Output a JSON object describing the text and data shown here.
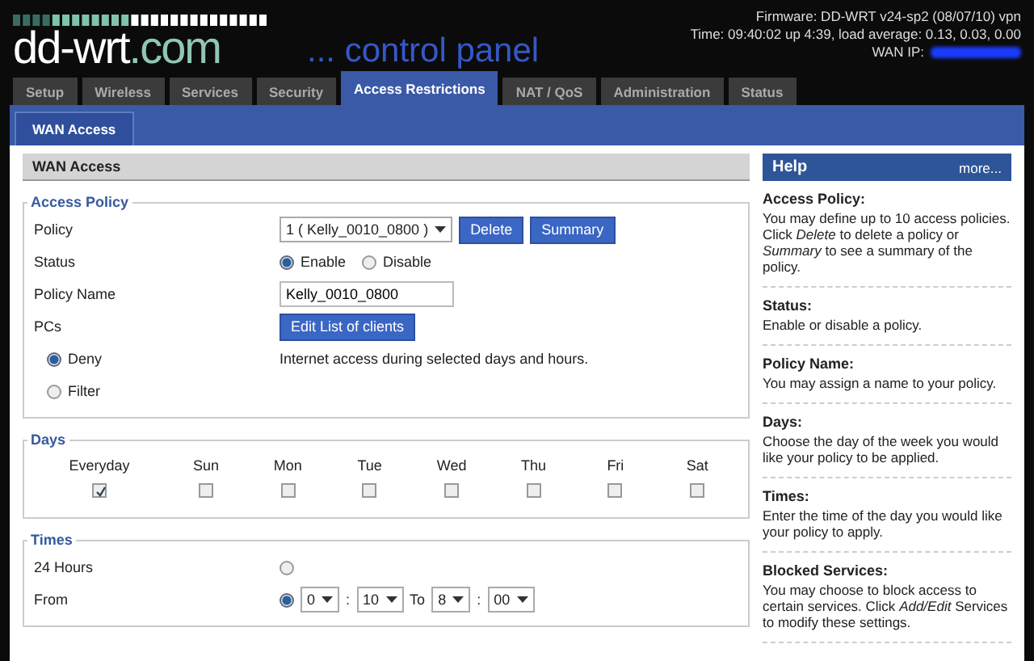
{
  "header": {
    "logo_main": "dd-wrt",
    "logo_domain": ".com",
    "tagline": "... control panel",
    "firmware": "Firmware: DD-WRT v24-sp2 (08/07/10) vpn",
    "time": "Time: 09:40:02 up 4:39, load average: 0.13, 0.03, 0.00",
    "wan_ip_label": "WAN IP:"
  },
  "tabs": [
    {
      "label": "Setup",
      "selected": false
    },
    {
      "label": "Wireless",
      "selected": false
    },
    {
      "label": "Services",
      "selected": false
    },
    {
      "label": "Security",
      "selected": false
    },
    {
      "label": "Access Restrictions",
      "selected": true
    },
    {
      "label": "NAT / QoS",
      "selected": false
    },
    {
      "label": "Administration",
      "selected": false
    },
    {
      "label": "Status",
      "selected": false
    }
  ],
  "subtabs": [
    {
      "label": "WAN Access",
      "selected": true
    }
  ],
  "main": {
    "title": "WAN Access",
    "access_policy": {
      "legend": "Access Policy",
      "policy_label": "Policy",
      "policy_value": "1 ( Kelly_0010_0800 )",
      "buttons": [
        "Delete",
        "Summary"
      ],
      "status_label": "Status",
      "status_options": [
        {
          "label": "Enable",
          "selected": true
        },
        {
          "label": "Disable",
          "selected": false
        }
      ],
      "name_label": "Policy Name",
      "name_value": "Kelly_0010_0800",
      "pcs_label": "PCs",
      "pcs_button": "Edit List of clients",
      "modes": [
        {
          "label": "Deny",
          "selected": true
        },
        {
          "label": "Filter",
          "selected": false
        }
      ],
      "mode_description": "Internet access during selected days and hours."
    },
    "days": {
      "legend": "Days",
      "items": [
        {
          "label": "Everyday",
          "checked": true
        },
        {
          "label": "Sun",
          "checked": false
        },
        {
          "label": "Mon",
          "checked": false
        },
        {
          "label": "Tue",
          "checked": false
        },
        {
          "label": "Wed",
          "checked": false
        },
        {
          "label": "Thu",
          "checked": false
        },
        {
          "label": "Fri",
          "checked": false
        },
        {
          "label": "Sat",
          "checked": false
        }
      ]
    },
    "times": {
      "legend": "Times",
      "all_day_label": "24 Hours",
      "all_day_selected": false,
      "from_label": "From",
      "from_selected": true,
      "from_hour": "0",
      "from_minute": "10",
      "to_label": "To",
      "to_hour": "8",
      "to_minute": "00",
      "separator": ":"
    }
  },
  "help": {
    "title": "Help",
    "more": "more...",
    "sections": [
      {
        "heading": "Access Policy:",
        "text": "You may define up to 10 access policies. Click *Delete* to delete a policy or *Summary* to see a summary of the policy."
      },
      {
        "heading": "Status:",
        "text": "Enable or disable a policy."
      },
      {
        "heading": "Policy Name:",
        "text": "You may assign a name to your policy."
      },
      {
        "heading": "Days:",
        "text": "Choose the day of the week you would like your policy to be applied."
      },
      {
        "heading": "Times:",
        "text": "Enter the time of the day you would like your policy to apply."
      },
      {
        "heading": "Blocked Services:",
        "text": "You may choose to block access to certain services. Click *Add/Edit* Services to modify these settings."
      }
    ]
  }
}
